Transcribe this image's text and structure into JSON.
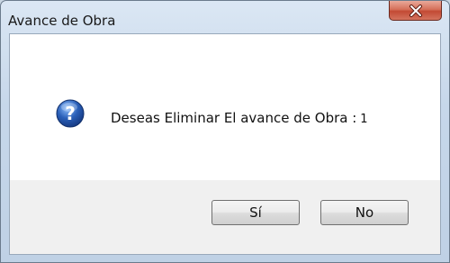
{
  "window": {
    "title": "Avance de Obra",
    "close_icon": "close-icon"
  },
  "dialog": {
    "icon": "question-icon",
    "message": "Deseas Eliminar El avance de Obra :",
    "value": "1"
  },
  "buttons": {
    "yes_label": "Sí",
    "no_label": "No"
  },
  "colors": {
    "close_button": "#c24a34",
    "question_icon": "#2a5fb8"
  }
}
